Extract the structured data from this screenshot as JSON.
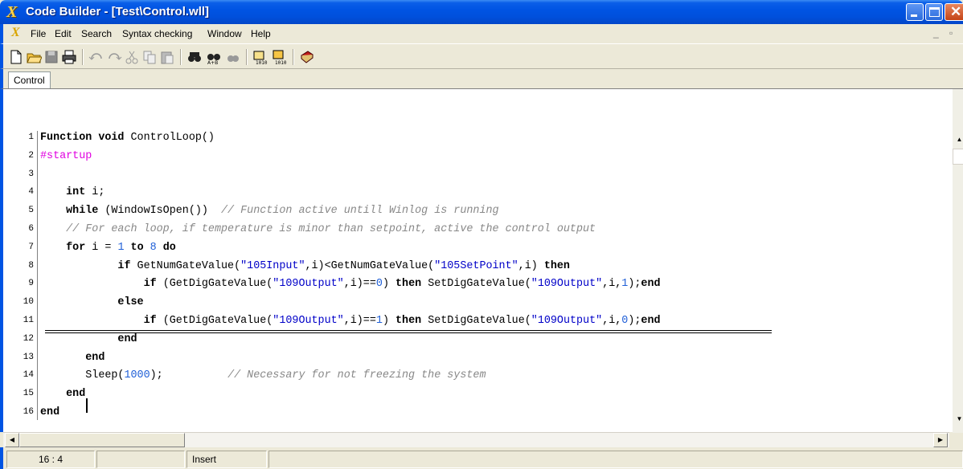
{
  "window": {
    "title": "Code Builder - [Test\\Control.wll]"
  },
  "menu": {
    "items": [
      "File",
      "Edit",
      "Search",
      "Syntax checking",
      "Window",
      "Help"
    ]
  },
  "toolbar": {
    "buttons": [
      "new-file-icon",
      "open-folder-icon",
      "save-icon",
      "print-icon",
      "undo-icon",
      "redo-icon",
      "cut-icon",
      "copy-icon",
      "paste-icon",
      "find-icon",
      "replace-icon",
      "find-next-icon",
      "compile-icon",
      "compile-all-icon",
      "help-book-icon"
    ]
  },
  "tabs": [
    {
      "label": "Control"
    }
  ],
  "editor": {
    "line_numbers": [
      "1",
      "2",
      "3",
      "4",
      "5",
      "6",
      "7",
      "8",
      "9",
      "10",
      "11",
      "12",
      "13",
      "14",
      "15",
      "16"
    ],
    "lines": [
      [
        {
          "t": "Function void ",
          "c": "kw"
        },
        {
          "t": "ControlLoop()",
          "c": ""
        }
      ],
      [
        {
          "t": "#startup",
          "c": "pp"
        }
      ],
      [
        {
          "t": "",
          "c": ""
        }
      ],
      [
        {
          "t": "    int ",
          "c": "kw"
        },
        {
          "t": "i;",
          "c": ""
        }
      ],
      [
        {
          "t": "    while ",
          "c": "kw"
        },
        {
          "t": "(WindowIsOpen())  ",
          "c": ""
        },
        {
          "t": "// Function active untill Winlog is running",
          "c": "cm"
        }
      ],
      [
        {
          "t": "    // For each loop, if temperature is minor than setpoint, active the control output",
          "c": "cm"
        }
      ],
      [
        {
          "t": "    for ",
          "c": "kw"
        },
        {
          "t": "i = ",
          "c": ""
        },
        {
          "t": "1",
          "c": "num"
        },
        {
          "t": " to ",
          "c": "kw"
        },
        {
          "t": "8",
          "c": "num"
        },
        {
          "t": " do",
          "c": "kw"
        }
      ],
      [
        {
          "t": "            if ",
          "c": "kw"
        },
        {
          "t": "GetNumGateValue(",
          "c": ""
        },
        {
          "t": "\"105Input\"",
          "c": "str"
        },
        {
          "t": ",i)<GetNumGateValue(",
          "c": ""
        },
        {
          "t": "\"105SetPoint\"",
          "c": "str"
        },
        {
          "t": ",i) ",
          "c": ""
        },
        {
          "t": "then",
          "c": "kw"
        }
      ],
      [
        {
          "t": "                if ",
          "c": "kw"
        },
        {
          "t": "(GetDigGateValue(",
          "c": ""
        },
        {
          "t": "\"109Output\"",
          "c": "str"
        },
        {
          "t": ",i)==",
          "c": ""
        },
        {
          "t": "0",
          "c": "num"
        },
        {
          "t": ") ",
          "c": ""
        },
        {
          "t": "then ",
          "c": "kw"
        },
        {
          "t": "SetDigGateValue(",
          "c": ""
        },
        {
          "t": "\"109Output\"",
          "c": "str"
        },
        {
          "t": ",i,",
          "c": ""
        },
        {
          "t": "1",
          "c": "num"
        },
        {
          "t": ");",
          "c": ""
        },
        {
          "t": "end",
          "c": "kw"
        }
      ],
      [
        {
          "t": "            else",
          "c": "kw"
        }
      ],
      [
        {
          "t": "                if ",
          "c": "kw"
        },
        {
          "t": "(GetDigGateValue(",
          "c": ""
        },
        {
          "t": "\"109Output\"",
          "c": "str"
        },
        {
          "t": ",i)==",
          "c": ""
        },
        {
          "t": "1",
          "c": "num"
        },
        {
          "t": ") ",
          "c": ""
        },
        {
          "t": "then ",
          "c": "kw"
        },
        {
          "t": "SetDigGateValue(",
          "c": ""
        },
        {
          "t": "\"109Output\"",
          "c": "str"
        },
        {
          "t": ",i,",
          "c": ""
        },
        {
          "t": "0",
          "c": "num"
        },
        {
          "t": ");",
          "c": ""
        },
        {
          "t": "end",
          "c": "kw"
        }
      ],
      [
        {
          "t": "            end",
          "c": "kw"
        }
      ],
      [
        {
          "t": "       end",
          "c": "kw"
        }
      ],
      [
        {
          "t": "       Sleep(",
          "c": ""
        },
        {
          "t": "1000",
          "c": "num"
        },
        {
          "t": ");          ",
          "c": ""
        },
        {
          "t": "// Necessary for not freezing the system",
          "c": "cm"
        }
      ],
      [
        {
          "t": "    end",
          "c": "kw"
        }
      ],
      [
        {
          "t": "end",
          "c": "kw"
        }
      ]
    ]
  },
  "statusbar": {
    "cursor_position": "16 : 4",
    "modified": "",
    "mode": "Insert"
  }
}
